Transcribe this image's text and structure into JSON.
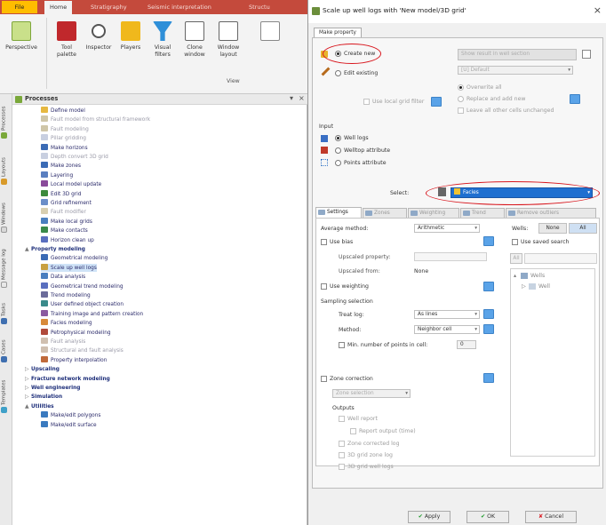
{
  "ribbon": {
    "tabs": [
      "File",
      "Home",
      "Stratigraphy",
      "Seismic interpretation",
      "Structu"
    ],
    "buttons": [
      {
        "label": "Perspective",
        "icon": "perspective-icon"
      },
      {
        "label": "Tool palette",
        "icon": "tool-palette-icon"
      },
      {
        "label": "Inspector",
        "icon": "inspector-icon"
      },
      {
        "label": "Players",
        "icon": "players-icon"
      },
      {
        "label": "Visual filters",
        "icon": "visual-filters-icon"
      },
      {
        "label": "Clone window",
        "icon": "clone-window-icon"
      },
      {
        "label": "Window layout",
        "icon": "window-layout-icon"
      }
    ],
    "group_label": "View"
  },
  "side_tabs": [
    "Processes",
    "Layouts",
    "Windows",
    "Message log",
    "Tasks",
    "Cases",
    "Templates"
  ],
  "processes": {
    "title": "Processes",
    "items": [
      {
        "label": "Define model",
        "indent": 2,
        "state": "normal",
        "color": "#e6b840"
      },
      {
        "label": "Fault model from structural framework",
        "indent": 2,
        "state": "dim",
        "color": "#cfc6a8"
      },
      {
        "label": "Fault modeling",
        "indent": 2,
        "state": "dim",
        "color": "#cfc6a8"
      },
      {
        "label": "Pillar gridding",
        "indent": 2,
        "state": "dim",
        "color": "#c8cfe0"
      },
      {
        "label": "Make horizons",
        "indent": 2,
        "state": "normal",
        "color": "#3b6bb5"
      },
      {
        "label": "Depth convert 3D grid",
        "indent": 2,
        "state": "dim",
        "color": "#c8cfe0"
      },
      {
        "label": "Make zones",
        "indent": 2,
        "state": "normal",
        "color": "#3b6bb5"
      },
      {
        "label": "Layering",
        "indent": 2,
        "state": "normal",
        "color": "#5a7fc0"
      },
      {
        "label": "Local model update",
        "indent": 2,
        "state": "normal",
        "color": "#8a4a9a"
      },
      {
        "label": "Edit 3D grid",
        "indent": 2,
        "state": "normal",
        "color": "#3c8a3c"
      },
      {
        "label": "Grid refinement",
        "indent": 2,
        "state": "normal",
        "color": "#6b8ec8"
      },
      {
        "label": "Fault modifier",
        "indent": 2,
        "state": "dim",
        "color": "#d8cfb0"
      },
      {
        "label": "Make local grids",
        "indent": 2,
        "state": "normal",
        "color": "#4a7fbf"
      },
      {
        "label": "Make contacts",
        "indent": 2,
        "state": "normal",
        "color": "#3a8a4a"
      },
      {
        "label": "Horizon clean up",
        "indent": 2,
        "state": "normal",
        "color": "#5a6fbf"
      },
      {
        "label": "Property modeling",
        "indent": 0,
        "state": "group",
        "arrow": "▲",
        "color": ""
      },
      {
        "label": "Geometrical modeling",
        "indent": 2,
        "state": "normal",
        "color": "#3b6bb5"
      },
      {
        "label": "Scale up well logs",
        "indent": 2,
        "state": "selected",
        "color": "#c8a040"
      },
      {
        "label": "Data analysis",
        "indent": 2,
        "state": "normal",
        "color": "#4a7fbf"
      },
      {
        "label": "Geometrical trend modeling",
        "indent": 2,
        "state": "normal",
        "color": "#5a6fbf"
      },
      {
        "label": "Trend modeling",
        "indent": 2,
        "state": "normal",
        "color": "#6b6b9a"
      },
      {
        "label": "User defined object creation",
        "indent": 2,
        "state": "normal",
        "color": "#3a8a8a"
      },
      {
        "label": "Training image and pattern creation",
        "indent": 2,
        "state": "normal",
        "color": "#8a5aa0"
      },
      {
        "label": "Facies modeling",
        "indent": 2,
        "state": "normal",
        "color": "#d88a3a"
      },
      {
        "label": "Petrophysical modeling",
        "indent": 2,
        "state": "normal",
        "color": "#b04a3a"
      },
      {
        "label": "Fault analysis",
        "indent": 2,
        "state": "dim",
        "color": "#d0c0b0"
      },
      {
        "label": "Structural and fault analysis",
        "indent": 2,
        "state": "dim",
        "color": "#d0c0b0"
      },
      {
        "label": "Property interpolation",
        "indent": 2,
        "state": "normal",
        "color": "#c06a3a"
      },
      {
        "label": "Upscaling",
        "indent": 0,
        "state": "group",
        "arrow": "▷",
        "color": ""
      },
      {
        "label": "Fracture network modeling",
        "indent": 0,
        "state": "group",
        "arrow": "▷",
        "color": ""
      },
      {
        "label": "Well engineering",
        "indent": 0,
        "state": "group",
        "arrow": "▷",
        "color": ""
      },
      {
        "label": "Simulation",
        "indent": 0,
        "state": "group",
        "arrow": "▷",
        "color": ""
      },
      {
        "label": "Utilities",
        "indent": 0,
        "state": "group",
        "arrow": "▲",
        "color": ""
      },
      {
        "label": "Make/edit polygons",
        "indent": 2,
        "state": "normal",
        "color": "#3a7abf"
      },
      {
        "label": "Make/edit surface",
        "indent": 2,
        "state": "normal",
        "color": "#3a7abf"
      }
    ]
  },
  "dialog": {
    "title": "Scale up well logs with 'New model/3D grid'",
    "close": "×",
    "main_tab": "Make property",
    "radio_create": "Create new",
    "radio_edit": "Edit existing",
    "show_result_label": "Show result in well section",
    "default_combo": "[U] Default",
    "overwrite_all": "Overwrite all",
    "replace_and_add": "Replace and add new",
    "leave_unchanged": "Leave all other cells unchanged",
    "use_local_grid_filter": "Use local grid filter",
    "input_label": "Input",
    "input_options": [
      "Well logs",
      "Welltop attribute",
      "Points attribute"
    ],
    "select_label": "Select:",
    "select_value": "Facies",
    "subtabs": [
      "Settings",
      "Zones",
      "Weighting",
      "Trend",
      "Remove outliers"
    ],
    "settings": {
      "average_method_label": "Average method:",
      "average_method_value": "Arithmetic",
      "use_bias": "Use bias",
      "upscaled_property_label": "Upscaled property:",
      "upscaled_from_label": "Upscaled from:",
      "upscaled_from_value": "None",
      "use_weighting": "Use weighting",
      "sampling_selection": "Sampling selection",
      "treat_log_label": "Treat log:",
      "treat_log_value": "As lines",
      "method_label": "Method:",
      "method_value": "Neighbor cell",
      "min_points_label": "Min. number of points in cell:",
      "min_points_value": "0",
      "zone_correction": "Zone correction",
      "zone_selection": "Zone selection",
      "outputs_label": "Outputs",
      "well_report": "Well report",
      "report_output_label": "Report output (time)",
      "zone_corrected_log": "Zone corrected log",
      "grid_zone_log": "3D grid zone log",
      "grid_well_logs": "3D grid well logs"
    },
    "wells": {
      "label": "Wells:",
      "none_btn": "None",
      "all_btn": "All",
      "use_saved_search": "Use saved search",
      "all_field": "All",
      "tree_root": "Wells",
      "tree_child": "Well"
    },
    "buttons": {
      "apply": "Apply",
      "ok": "OK",
      "cancel": "Cancel"
    }
  }
}
